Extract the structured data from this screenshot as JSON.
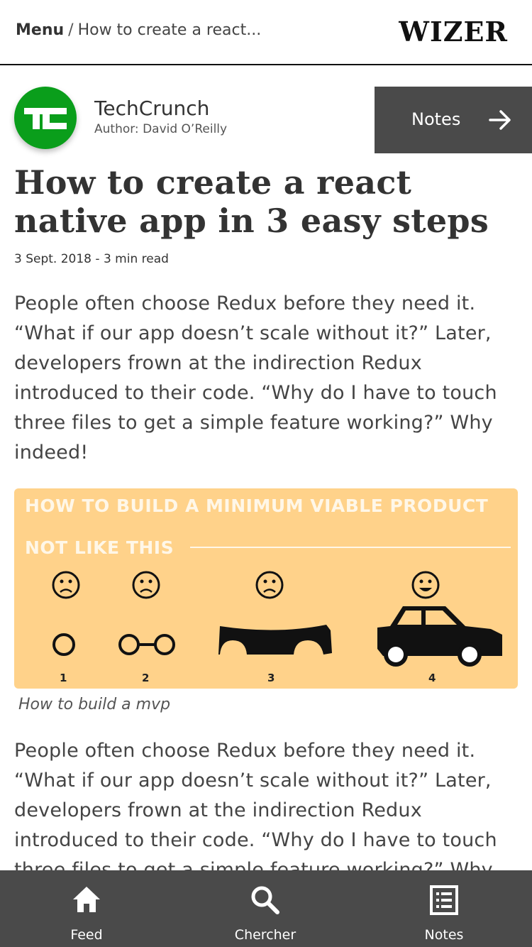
{
  "header": {
    "menu_label": "Menu",
    "separator": "/",
    "breadcrumb_title": "How to create a react...",
    "brand": "WIZER"
  },
  "source": {
    "name": "TechCrunch",
    "author": "Author: David O’Reilly",
    "logo_color": "#0a9e1b"
  },
  "notes_button": {
    "label": "Notes",
    "icon": "arrow-right-icon"
  },
  "article": {
    "title": "How to create a react native app in 3 easy steps",
    "meta": "3 Sept. 2018 - 3 min read",
    "paragraph1": "People often choose Redux before they need it. “What if our app doesn’t scale without it?” Later, developers frown at the indirection Redux introduced to their code. “Why do I have to touch three files to get a simple feature working?” Why indeed!",
    "paragraph2": "People often choose Redux before they need it. “What if our app doesn’t scale without it?” Later, developers frown at the indirection Redux introduced to their code. “Why do I have to touch three files to get a simple feature working?” Why indeed!"
  },
  "figure": {
    "heading": "HOW TO BUILD A MINIMUM VIABLE PRODUCT",
    "subheading": "NOT LIKE THIS",
    "step1": "1",
    "step2": "2",
    "step3": "3",
    "step4": "4",
    "background": "#ffd28a",
    "caption": "How to build a mvp"
  },
  "tabbar": {
    "background": "#4a4a4a",
    "tabs": [
      {
        "label": "Feed",
        "icon": "home-icon"
      },
      {
        "label": "Chercher",
        "icon": "search-icon"
      },
      {
        "label": "Notes",
        "icon": "list-icon"
      }
    ]
  }
}
